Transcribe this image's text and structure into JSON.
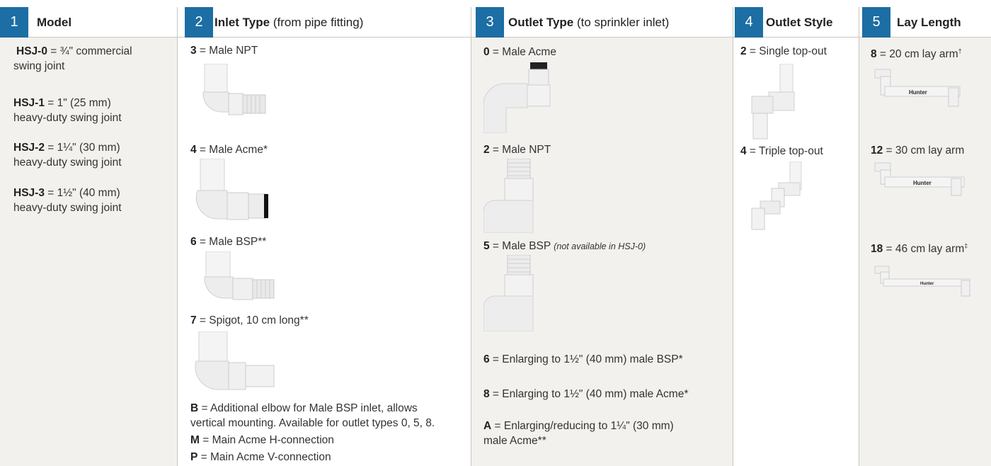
{
  "columns": [
    {
      "num": "1",
      "title": "Model",
      "subtitle": ""
    },
    {
      "num": "2",
      "title": "Inlet Type",
      "subtitle": " (from pipe fitting)"
    },
    {
      "num": "3",
      "title": "Outlet Type",
      "subtitle": " (to sprinkler inlet)"
    },
    {
      "num": "4",
      "title": "Outlet Style",
      "subtitle": ""
    },
    {
      "num": "5",
      "title": "Lay Length",
      "subtitle": ""
    }
  ],
  "model": {
    "items": [
      {
        "code": "HSJ-0",
        "line1": " = ¾\" commercial",
        "line2": "swing joint"
      },
      {
        "code": "HSJ-1",
        "line1": " = 1\" (25 mm)",
        "line2": "heavy-duty swing joint"
      },
      {
        "code": "HSJ-2",
        "line1": " = 1¼\" (30 mm)",
        "line2": "heavy-duty swing joint"
      },
      {
        "code": "HSJ-3",
        "line1": " = 1½\" (40 mm)",
        "line2": "heavy-duty swing joint"
      }
    ]
  },
  "inlet": {
    "items": [
      {
        "code": "3",
        "text": " = Male NPT"
      },
      {
        "code": "4",
        "text": " = Male Acme*"
      },
      {
        "code": "6",
        "text": " = Male BSP**"
      },
      {
        "code": "7",
        "text": " = Spigot, 10 cm long**"
      }
    ],
    "b_code": "B",
    "b_line1": "  = Additional elbow for Male BSP inlet, allows",
    "b_line2": "vertical mounting.  Available for outlet types 0, 5, 8.",
    "m_code": "M",
    "m_text": "  = Main Acme H-connection",
    "p_code": "P",
    "p_text": "  = Main Acme V-connection"
  },
  "outlet": {
    "items": [
      {
        "code": "0",
        "text": " = Male Acme",
        "note": ""
      },
      {
        "code": "2",
        "text": " = Male NPT",
        "note": ""
      },
      {
        "code": "5",
        "text": " = Male BSP ",
        "note": "(not available in HSJ-0)"
      },
      {
        "code": "6",
        "text": " = Enlarging to 1½\" (40 mm) male BSP*",
        "note": ""
      },
      {
        "code": "8",
        "text": " = Enlarging to 1½\" (40 mm) male Acme*",
        "note": ""
      }
    ],
    "a_code": "A",
    "a_line1": " = Enlarging/reducing to 1¼\" (30 mm)",
    "a_line2": "male Acme**"
  },
  "style": {
    "items": [
      {
        "code": "2",
        "text": " = Single top-out"
      },
      {
        "code": "4",
        "text": " = Triple top-out"
      }
    ]
  },
  "lay": {
    "items": [
      {
        "code": "8",
        "text": " = 20 cm lay arm",
        "mark": "†"
      },
      {
        "code": "12",
        "text": " = 30 cm lay arm",
        "mark": ""
      },
      {
        "code": "18",
        "text": " = 46 cm lay arm",
        "mark": "‡"
      }
    ],
    "brand": "Hunter"
  },
  "colors": {
    "header_num_bg": "#1c6ea4",
    "shaded_column": "#f3f1ee",
    "border": "#c9c6bf"
  }
}
